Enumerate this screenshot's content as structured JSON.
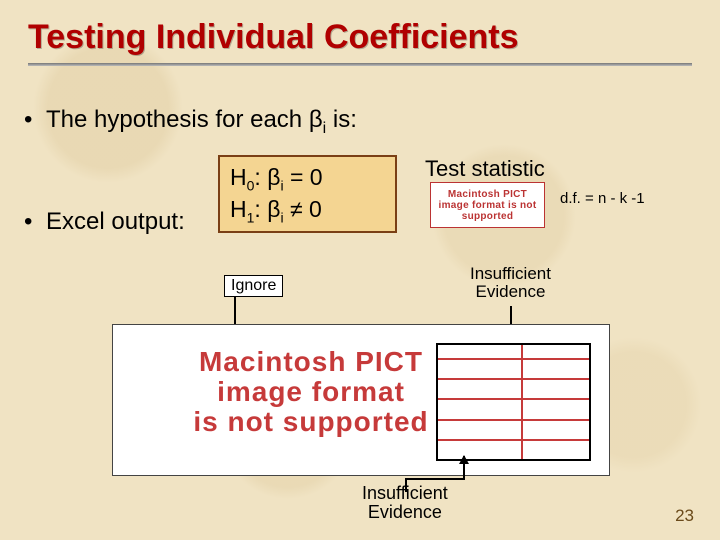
{
  "title": "Testing Individual Coefficients",
  "bullets": {
    "hypothesis_prefix": "The hypothesis for each ",
    "beta_i": "β",
    "hypothesis_suffix": " is:",
    "excel_output": "Excel output:"
  },
  "hypothesis_box": {
    "h0_label": "H",
    "h0_sub": "0",
    "h0_rest": ":  β",
    "h0_i": "i",
    "h0_eq": " = 0",
    "h1_label": "H",
    "h1_sub": "1",
    "h1_rest": ":  β",
    "h1_i": "i",
    "h1_ne": " ≠ 0"
  },
  "test_statistic_label": "Test statistic",
  "df_text": "d.f. = n - k -1",
  "pict_text_small": "Macintosh PICT image format is not supported",
  "pict_text_big_l1": "Macintosh PICT",
  "pict_text_big_l2": "image format",
  "pict_text_big_l3": "is not supported",
  "ignore_label": "Ignore",
  "insufficient1_l1": "Insufficient",
  "insufficient1_l2": "Evidence",
  "insufficient2_l1": "Insufficient",
  "insufficient2_l2": "Evidence",
  "page_number": "23"
}
